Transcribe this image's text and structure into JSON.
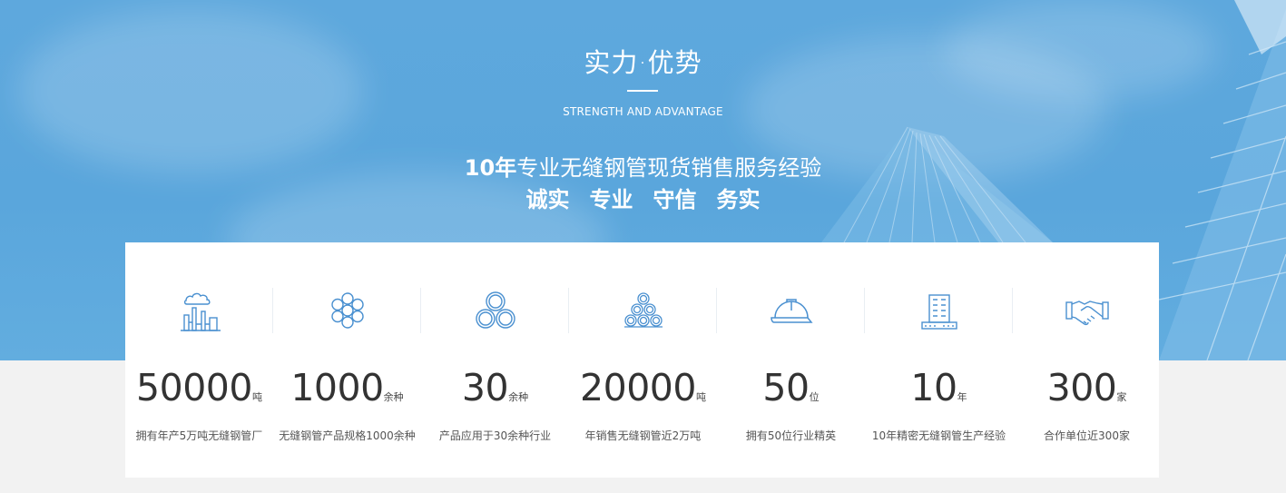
{
  "section": {
    "title": "实力·优势",
    "subtitle": "STRENGTH AND ADVANTAGE",
    "slogan_number": "10年",
    "slogan_text": "专业无缝钢管现货销售服务经验",
    "motto": [
      "诚实",
      "专业",
      "守信",
      "务实"
    ]
  },
  "stats": [
    {
      "icon": "factory-icon",
      "value": "50000",
      "unit": "吨",
      "caption": "拥有年产5万吨无缝钢管厂"
    },
    {
      "icon": "pipe-cluster-icon",
      "value": "1000",
      "unit": "余种",
      "caption": "无缝钢管产品规格1000余种"
    },
    {
      "icon": "pipe-stack-icon",
      "value": "30",
      "unit": "余种",
      "caption": "产品应用于30余种行业"
    },
    {
      "icon": "pipe-pile-icon",
      "value": "20000",
      "unit": "吨",
      "caption": "年销售无缝钢管近2万吨"
    },
    {
      "icon": "hard-hat-icon",
      "value": "50",
      "unit": "位",
      "caption": "拥有50位行业精英"
    },
    {
      "icon": "building-icon",
      "value": "10",
      "unit": "年",
      "caption": "10年精密无缝钢管生产经验"
    },
    {
      "icon": "handshake-icon",
      "value": "300",
      "unit": "家",
      "caption": "合作单位近300家"
    }
  ],
  "colors": {
    "hero_blue": "#5ea8dd",
    "icon_blue": "#4a90d0",
    "panel": "#ffffff",
    "value_text": "#333333"
  }
}
